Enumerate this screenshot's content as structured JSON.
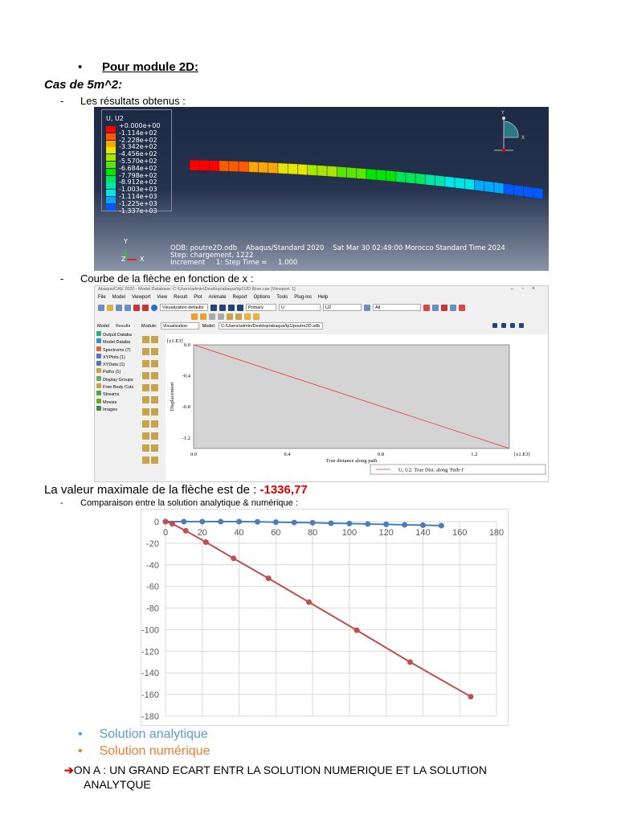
{
  "heading": {
    "bullet": "•",
    "title": "Pour module 2D:"
  },
  "subheading": "Cas de 5m^2:",
  "items": {
    "results": "Les résultats obtenus :",
    "curve": "Courbe de la flèche en fonction de x :",
    "comparison": "Comparaison entre la solution analytique & numérique :",
    "dash": "-"
  },
  "contour": {
    "title": "U, U2",
    "legend": [
      {
        "label": "+0.000e+00",
        "color": "#ff0000"
      },
      {
        "label": "-1.114e+02",
        "color": "#ff5a00"
      },
      {
        "label": "-2.228e+02",
        "color": "#ffa500"
      },
      {
        "label": "-3.342e+02",
        "color": "#e6e600"
      },
      {
        "label": "-4.456e+02",
        "color": "#a8e600"
      },
      {
        "label": "-5.570e+02",
        "color": "#5ae600"
      },
      {
        "label": "-6.684e+02",
        "color": "#00e600"
      },
      {
        "label": "-7.798e+02",
        "color": "#00e65a"
      },
      {
        "label": "-8.912e+02",
        "color": "#00e6a8"
      },
      {
        "label": "-1.003e+03",
        "color": "#00e6e6"
      },
      {
        "label": "-1.114e+03",
        "color": "#00a8ff"
      },
      {
        "label": "-1.225e+03",
        "color": "#005aff"
      },
      {
        "label": "-1.337e+03",
        "color": "#0000ff"
      }
    ],
    "info": "ODB: poutre2D.odb    Abaqus/Standard 2020    Sat Mar 30 02:49:00 Morocco Standard Time 2024\nStep: chargement, 1222\nIncrement     1: Step Time =     1.000",
    "triad": {
      "y": "Y",
      "x": "X",
      "z": "Z"
    }
  },
  "abaqus": {
    "title": "Abaqus/CAE 2020 - Model Database: C:\\Users\\admin\\Desktop\\abaqus\\tp1\\2D flèxe.cae [Viewport: 1]",
    "menu": [
      "File",
      "Model",
      "Viewport",
      "View",
      "Result",
      "Plot",
      "Animate",
      "Report",
      "Options",
      "Tools",
      "Plug-ins",
      "Help"
    ],
    "toolbar": {
      "viz_defaults": "Visualization defaults",
      "primary": "Primary",
      "var": "U",
      "comp": "U2",
      "all": "All"
    },
    "module_label": "Module:",
    "module": "Visualization",
    "model_label": "Model:",
    "model": "C:/Users/admin/Desktop/abaqus/tp1/poutre2D.odb",
    "tabs": [
      "Model",
      "Results"
    ],
    "tree": [
      "Output Databa",
      "Model Databa",
      "Spectrums (7)",
      "XYPlots (1)",
      "XYData (1)",
      "Paths (1)",
      "Display Groups",
      "Free Body Cuts",
      "Streams",
      "Movies",
      "Images"
    ],
    "plot": {
      "ymult": "[x1.E3]",
      "xmult": "[x1.E3]",
      "yticks": [
        "0.0",
        "-0.4",
        "-0.8",
        "-1.2"
      ],
      "xticks": [
        "0.0",
        "0.4",
        "0.8",
        "1.2"
      ],
      "ylabel": "Displacement",
      "xlabel": "True distance along path",
      "legend": "U, U2: True Dist. along 'Path-1'",
      "xmax": 1.35,
      "ymin": -1.3368
    }
  },
  "max_text": {
    "label": "La valeur maximale de la flèche est de : ",
    "value": "-1336,77"
  },
  "chart_data": {
    "type": "line",
    "xlim": [
      0,
      180
    ],
    "ylim": [
      -180,
      0
    ],
    "xticks": [
      "0",
      "20",
      "40",
      "60",
      "80",
      "100",
      "120",
      "140",
      "160",
      "180"
    ],
    "yticks": [
      "0",
      "-20",
      "-40",
      "-60",
      "-80",
      "-100",
      "-120",
      "-140",
      "-160",
      "-180"
    ],
    "series": [
      {
        "name": "Solution analytique",
        "color": "#4a7ebb",
        "x": [
          0,
          10,
          20,
          30,
          40,
          50,
          60,
          70,
          80,
          90,
          100,
          110,
          120,
          130,
          140,
          150
        ],
        "y": [
          0,
          0,
          0,
          0,
          0,
          -0.2,
          -0.5,
          -0.8,
          -1,
          -1.5,
          -1.8,
          -2.2,
          -2.5,
          -3,
          -3.3,
          -3.7
        ]
      },
      {
        "name": "Solution numérique",
        "color": "#c0504d",
        "x": [
          0,
          3.7,
          11,
          22,
          37,
          56,
          78,
          104,
          133,
          166
        ],
        "y": [
          0,
          -2,
          -8.5,
          -19,
          -34,
          -52.5,
          -74.5,
          -100.5,
          -130,
          -162
        ]
      }
    ]
  },
  "legend": [
    {
      "label": "Solution analytique",
      "color": "#5b9bd5"
    },
    {
      "label": "Solution numérique",
      "color": "#ed7d31"
    }
  ],
  "conclusion": {
    "prefix": "ON A : UN GRAND ECART ENTR LA SOLUTION NUMERIQUE ET LA SOLUTION",
    "line2": "ANALYTQUE"
  }
}
